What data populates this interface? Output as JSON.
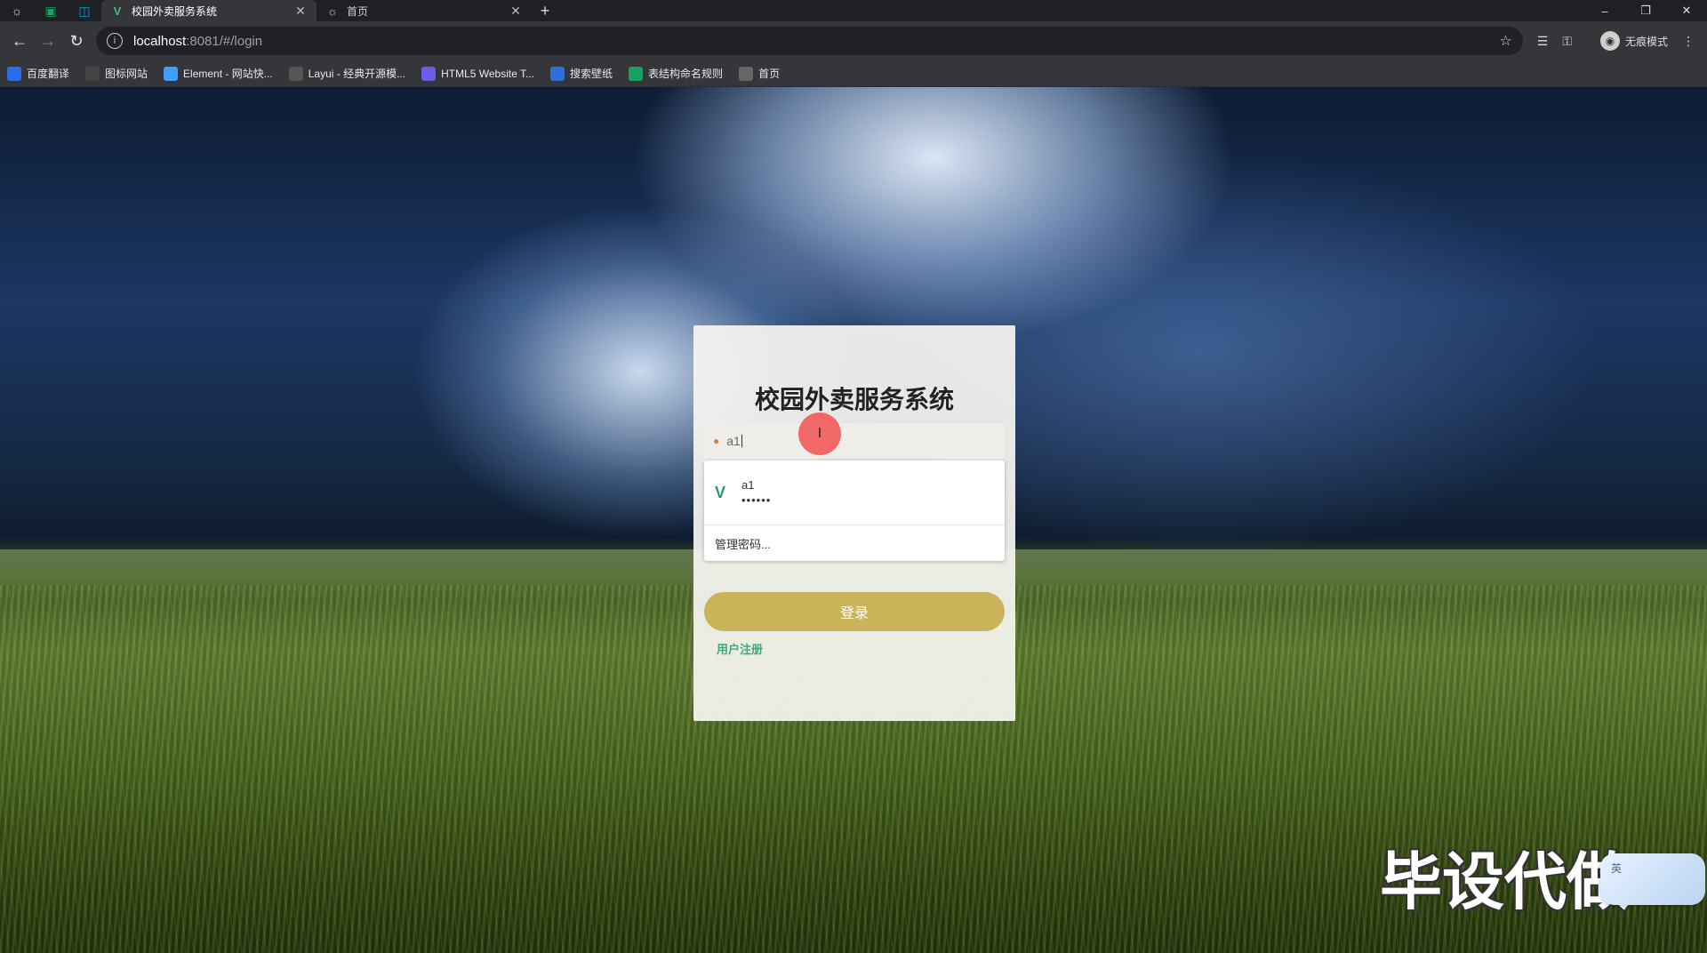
{
  "browser": {
    "tabs": [
      {
        "title": "校园外卖服务系统",
        "icon": "vue-logo-icon",
        "active": true
      },
      {
        "title": "首页",
        "icon": "globe-icon",
        "active": false
      }
    ],
    "url_host": "localhost",
    "url_path": ":8081/#/login",
    "profile_label": "无痕模式"
  },
  "bookmarks": [
    {
      "label": "百度翻译",
      "icon": "translate-icon",
      "color": "#2a6ee8"
    },
    {
      "label": "图标网站",
      "icon": "flag-icon",
      "color": "#444444"
    },
    {
      "label": "Element - 网站快...",
      "icon": "element-logo-icon",
      "color": "#409eff"
    },
    {
      "label": "Layui - 经典开源模...",
      "icon": "layui-logo-icon",
      "color": "#555555"
    },
    {
      "label": "HTML5 Website T...",
      "icon": "html5-icon",
      "color": "#6c5ce7"
    },
    {
      "label": "搜索壁纸",
      "icon": "wallpaper-icon",
      "color": "#2f6fd6"
    },
    {
      "label": "表结构命名规则",
      "icon": "sheet-icon",
      "color": "#1aa260"
    },
    {
      "label": "首页",
      "icon": "globe-icon",
      "color": "#666666"
    }
  ],
  "login": {
    "title": "校园外卖服务系统",
    "username_value": "a1",
    "autofill_username": "a1",
    "autofill_password": "••••••",
    "autofill_manage": "管理密码...",
    "login_button": "登录",
    "register_link": "用户注册"
  },
  "overlay": {
    "watermark": "毕设代做",
    "ime_label": "英"
  },
  "colors": {
    "login_button": "#c9b45a",
    "register_link": "#3da878"
  }
}
